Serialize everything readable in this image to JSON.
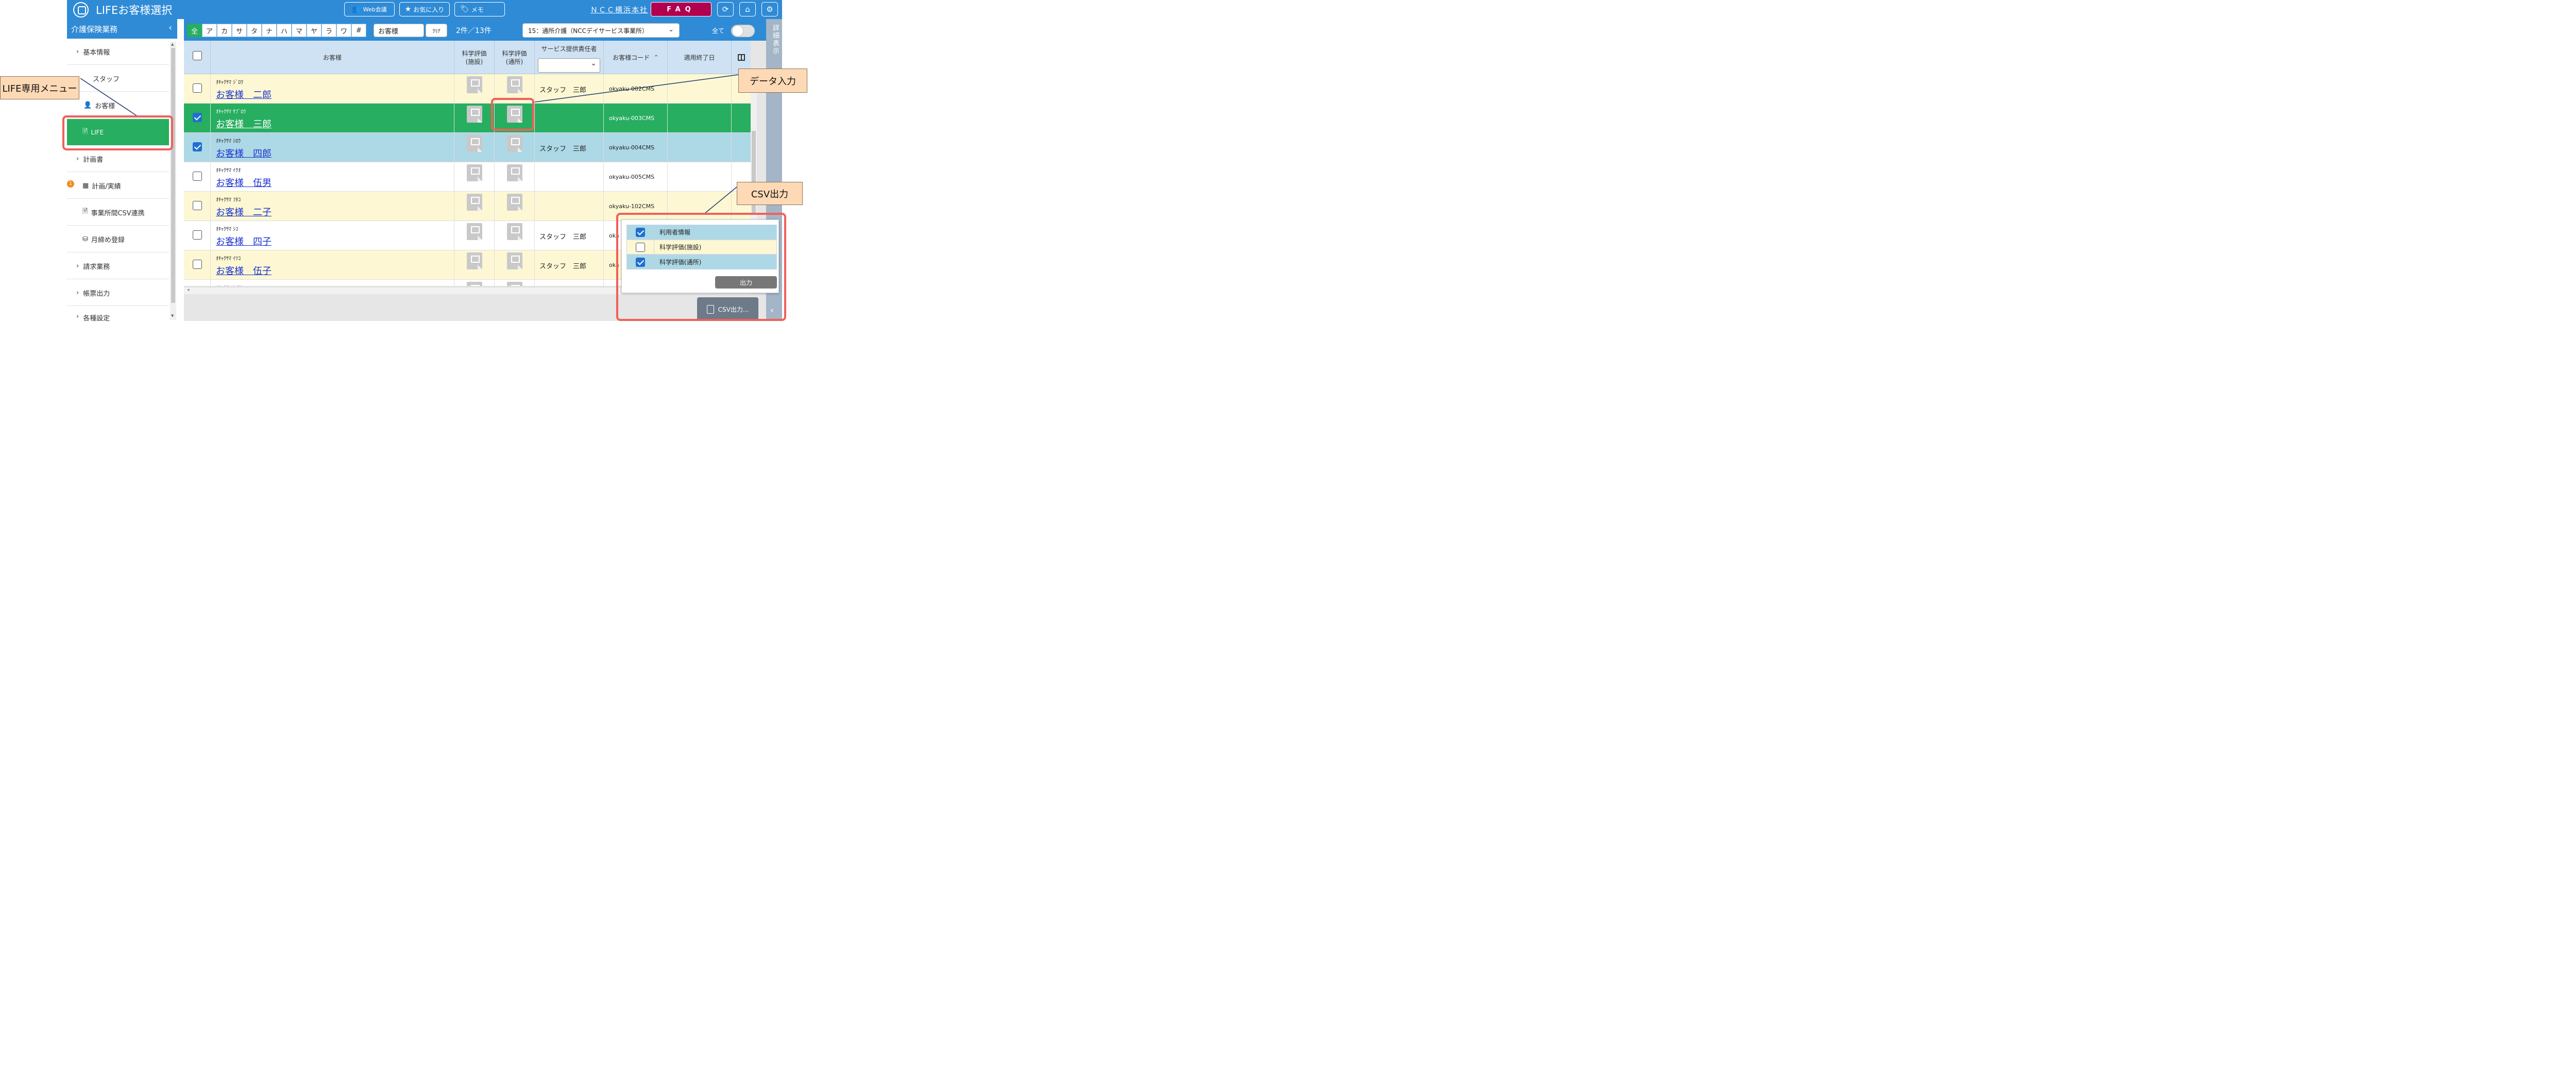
{
  "header": {
    "title": "LIFEお客様選択",
    "web_meeting": "Web会議",
    "favorites": "お気に入り",
    "memo": "メモ",
    "office_link": "ＮＣＣ横浜本社",
    "faq": "FAQ"
  },
  "sidebar": {
    "title": "介護保険業務",
    "items": [
      {
        "label": "基本情報"
      },
      {
        "label": "スタッフ"
      },
      {
        "label": "お客様"
      },
      {
        "label": "LIFE"
      },
      {
        "label": "計画書"
      },
      {
        "label": "計画/実績"
      },
      {
        "label": "事業所間CSV連携"
      },
      {
        "label": "月締め登録"
      },
      {
        "label": "請求業務"
      },
      {
        "label": "帳票出力"
      },
      {
        "label": "各種設定"
      }
    ],
    "badge": "1"
  },
  "toolbar": {
    "kana_filters": [
      "全",
      "ア",
      "カ",
      "サ",
      "タ",
      "ナ",
      "ハ",
      "マ",
      "ヤ",
      "ラ",
      "ワ",
      "#"
    ],
    "search_value": "お客様",
    "clear_label": "ｸﾘｱ",
    "count_text": "2件／13件",
    "office_select": "15：通所介護（NCCデイサービス事業所）",
    "all_label": "全て"
  },
  "table": {
    "columns": {
      "customer": "お客様",
      "sci_facility": "科学評価\n(施設)",
      "sci_daycare": "科学評価\n(通所)",
      "service_manager": "サービス提供責任者",
      "customer_code": "お客様コード",
      "end_date": "適用終了日"
    },
    "rows": [
      {
        "kana": "ｵｷｬｸｻﾏ ｼﾞﾛｳ",
        "name": "お客様　二郎",
        "staff": "スタッフ　三郎",
        "code": "okyaku-002CMS"
      },
      {
        "kana": "ｵｷｬｸｻﾏ ｻﾌﾞﾛｳ",
        "name": "お客様　三郎",
        "staff": "",
        "code": "okyaku-003CMS"
      },
      {
        "kana": "ｵｷｬｸｻﾏ ｼﾛｳ",
        "name": "お客様　四郎",
        "staff": "スタッフ　三郎",
        "code": "okyaku-004CMS"
      },
      {
        "kana": "ｵｷｬｸｻﾏ ｲｸｵ",
        "name": "お客様　伍男",
        "staff": "",
        "code": "okyaku-005CMS"
      },
      {
        "kana": "ｵｷｬｸｻﾏ ﾌﾀｺ",
        "name": "お客様　二子",
        "staff": "",
        "code": "okyaku-102CMS"
      },
      {
        "kana": "ｵｷｬｸｻﾏ ｼｺ",
        "name": "お客様　四子",
        "staff": "スタッフ　三郎",
        "code": "oka"
      },
      {
        "kana": "ｵｷｬｸｻﾏ ｲﾂｺ",
        "name": "お客様　伍子",
        "staff": "スタッフ　三郎",
        "code": "oka"
      },
      {
        "kana": "ｵｷｬｸｻﾏ ｹｲｽｹ",
        "name": "",
        "staff": "",
        "code": ""
      }
    ]
  },
  "right_panel": {
    "label": "詳細表示"
  },
  "csv_popup": {
    "options": [
      {
        "label": "利用者情報"
      },
      {
        "label": "科学評価(施設)"
      },
      {
        "label": "科学評価(通所)"
      }
    ],
    "output_button": "出力",
    "csv_button": "CSV出力..."
  },
  "callouts": {
    "life_menu": "LIFE専用メニュー",
    "data_entry": "データ入力",
    "csv_output": "CSV出力"
  },
  "colors": {
    "header_blue": "#2f8bd6",
    "selected_green": "#27ae60",
    "faq_crimson": "#b1004f",
    "row_yellow": "#fdf8d3",
    "row_blue": "#add8e6",
    "callout_fill": "#fdd9b5",
    "highlight_red": "#f0605a"
  }
}
